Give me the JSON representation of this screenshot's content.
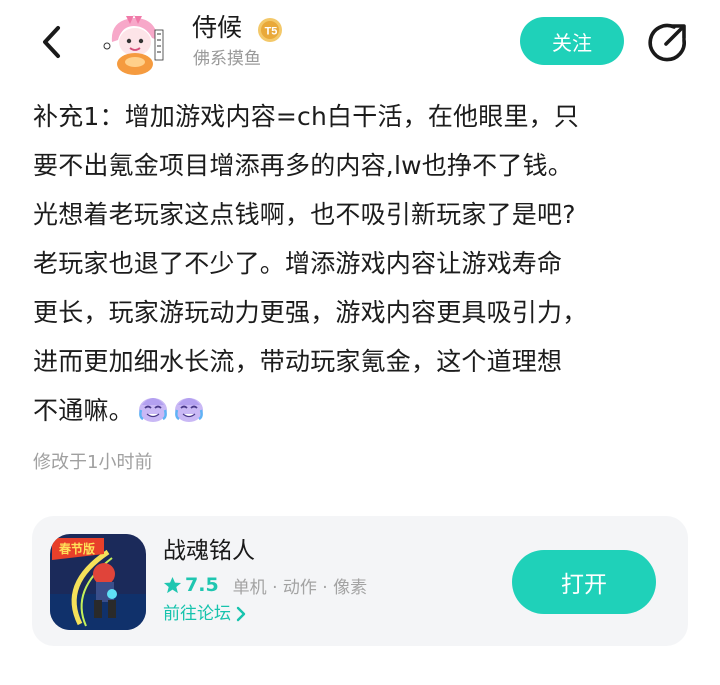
{
  "header": {
    "username": "侍候",
    "level_badge": "T5",
    "subtitle": "佛系摸鱼",
    "follow_label": "关注"
  },
  "post": {
    "lines": [
      "补充1：增加游戏内容=ch白干活，在他眼里，只",
      "要不出氪金项目增添再多的内容,lw也挣不了钱。",
      "光想着老玩家这点钱啊，也不吸引新玩家了是吧?",
      "老玩家也退了不少了。增添游戏内容让游戏寿命",
      "更长，玩家游玩动力更强，游戏内容更具吸引力，",
      "进而更加细水长流，带动玩家氪金，这个道理想",
      "不通嘛。"
    ],
    "emojis": [
      "crying-laughing-emoji",
      "crying-laughing-emoji"
    ],
    "modified": "修改于1小时前"
  },
  "game_card": {
    "title": "战魂铭人",
    "icon_badge": "春节版",
    "rating": "7.5",
    "tags": "单机 · 动作 · 像素",
    "forum_link": "前往论坛",
    "open_label": "打开"
  },
  "colors": {
    "accent": "#1fd1b9",
    "accent_text": "#17c3ad",
    "card_bg": "#f4f5f7",
    "muted": "#a0a0a0"
  }
}
